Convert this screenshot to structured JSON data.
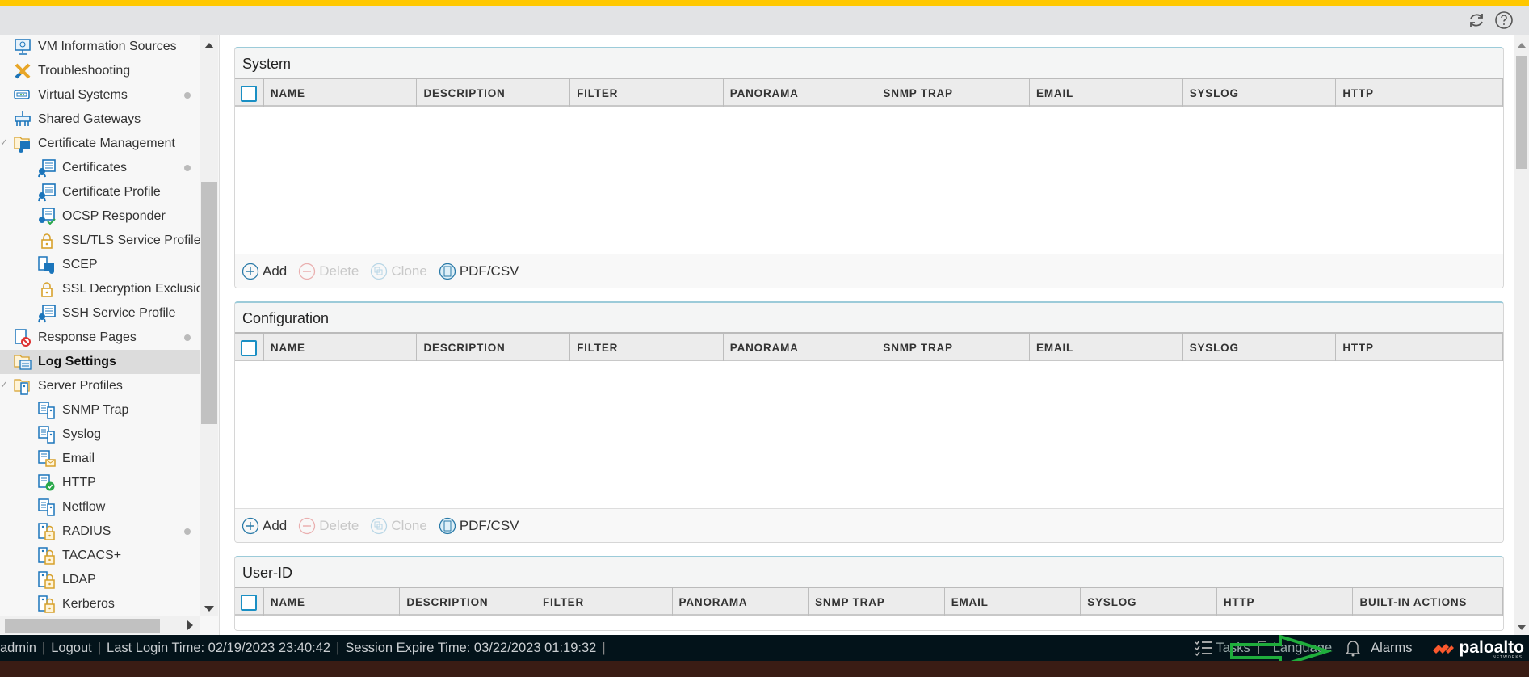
{
  "colors": {
    "accent_bar": "#ffc800",
    "footer_bg": "#03131a",
    "brand": "#fa582d",
    "annotation_arrow": "#1fad3c"
  },
  "header": {
    "icons": [
      "refresh-icon",
      "help-icon"
    ]
  },
  "sidebar": {
    "items": [
      {
        "label": "VM Information Sources",
        "level": 1,
        "icon": "monitor-icon",
        "dot": false
      },
      {
        "label": "Troubleshooting",
        "level": 1,
        "icon": "tools-icon",
        "dot": false
      },
      {
        "label": "Virtual Systems",
        "level": 1,
        "icon": "virtual-system-icon",
        "dot": true
      },
      {
        "label": "Shared Gateways",
        "level": 1,
        "icon": "gateway-icon",
        "dot": false
      },
      {
        "label": "Certificate Management",
        "level": 1,
        "icon": "folder-certificate-icon",
        "dot": false,
        "expanded": true
      },
      {
        "label": "Certificates",
        "level": 2,
        "icon": "certificate-icon",
        "dot": true
      },
      {
        "label": "Certificate Profile",
        "level": 2,
        "icon": "certificate-icon",
        "dot": false
      },
      {
        "label": "OCSP Responder",
        "level": 2,
        "icon": "certificate-check-icon",
        "dot": false
      },
      {
        "label": "SSL/TLS Service Profile",
        "level": 2,
        "icon": "lock-icon",
        "dot": false
      },
      {
        "label": "SCEP",
        "level": 2,
        "icon": "scep-icon",
        "dot": false
      },
      {
        "label": "SSL Decryption Exclusion",
        "level": 2,
        "icon": "lock-icon",
        "dot": false
      },
      {
        "label": "SSH Service Profile",
        "level": 2,
        "icon": "certificate-icon",
        "dot": false
      },
      {
        "label": "Response Pages",
        "level": 1,
        "icon": "response-pages-icon",
        "dot": true
      },
      {
        "label": "Log Settings",
        "level": 1,
        "icon": "folder-log-icon",
        "dot": false,
        "selected": true
      },
      {
        "label": "Server Profiles",
        "level": 1,
        "icon": "folder-server-icon",
        "dot": false,
        "expanded": true
      },
      {
        "label": "SNMP Trap",
        "level": 2,
        "icon": "server-profile-icon",
        "dot": false
      },
      {
        "label": "Syslog",
        "level": 2,
        "icon": "server-profile-icon",
        "dot": false
      },
      {
        "label": "Email",
        "level": 2,
        "icon": "email-profile-icon",
        "dot": false
      },
      {
        "label": "HTTP",
        "level": 2,
        "icon": "http-profile-icon",
        "dot": false
      },
      {
        "label": "Netflow",
        "level": 2,
        "icon": "server-profile-icon",
        "dot": false
      },
      {
        "label": "RADIUS",
        "level": 2,
        "icon": "auth-server-icon",
        "dot": true
      },
      {
        "label": "TACACS+",
        "level": 2,
        "icon": "auth-server-icon",
        "dot": false
      },
      {
        "label": "LDAP",
        "level": 2,
        "icon": "auth-server-icon",
        "dot": false
      },
      {
        "label": "Kerberos",
        "level": 2,
        "icon": "auth-server-icon",
        "dot": false
      }
    ]
  },
  "panels": [
    {
      "title": "System",
      "columns": [
        "NAME",
        "DESCRIPTION",
        "FILTER",
        "PANORAMA",
        "SNMP TRAP",
        "EMAIL",
        "SYSLOG",
        "HTTP"
      ],
      "actions": true
    },
    {
      "title": "Configuration",
      "columns": [
        "NAME",
        "DESCRIPTION",
        "FILTER",
        "PANORAMA",
        "SNMP TRAP",
        "EMAIL",
        "SYSLOG",
        "HTTP"
      ],
      "actions": true
    },
    {
      "title": "User-ID",
      "columns": [
        "NAME",
        "DESCRIPTION",
        "FILTER",
        "PANORAMA",
        "SNMP TRAP",
        "EMAIL",
        "SYSLOG",
        "HTTP",
        "BUILT-IN ACTIONS"
      ],
      "actions": false
    }
  ],
  "actions": {
    "add": "Add",
    "delete": "Delete",
    "clone": "Clone",
    "pdfcsv": "PDF/CSV"
  },
  "footer": {
    "user": "admin",
    "logout": "Logout",
    "last_login": "Last Login Time: 02/19/2023 23:40:42",
    "session_expire": "Session Expire Time: 03/22/2023 01:19:32",
    "tasks": "Tasks",
    "language": "Language",
    "alarms": "Alarms",
    "logo_text": "paloalto",
    "logo_sub": "NETWORKS"
  }
}
